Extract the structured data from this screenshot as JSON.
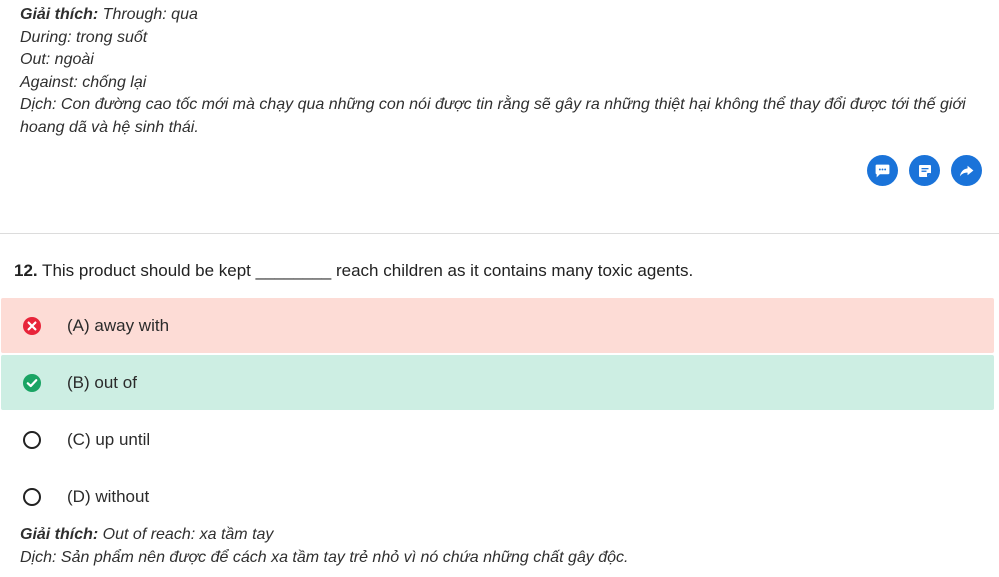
{
  "prev_explanation": {
    "label": "Giải thích:",
    "first": " Through: qua",
    "lines": [
      "During: trong suốt",
      "Out: ngoài",
      "Against: chống lại"
    ],
    "translation": "Dịch: Con đường cao tốc mới mà chạy qua những con nói được tin rằng sẽ gây ra những thiệt hại không thể thay đổi được tới thế giới hoang dã và hệ sinh thái."
  },
  "actions": [
    {
      "icon": "comment-icon"
    },
    {
      "icon": "note-icon"
    },
    {
      "icon": "share-icon"
    }
  ],
  "question": {
    "number": "12.",
    "text": " This product should be kept ________ reach children as it contains many toxic agents."
  },
  "options": [
    {
      "label": "(A) away with",
      "status": "wrong"
    },
    {
      "label": "(B) out of",
      "status": "correct"
    },
    {
      "label": "(C) up until",
      "status": "none"
    },
    {
      "label": "(D) without",
      "status": "none"
    }
  ],
  "explanation": {
    "label": "Giải thích:",
    "first": " Out of reach: xa tầm tay",
    "translation": "Dịch: Sản phẩm nên được để cách xa tầm tay trẻ nhỏ vì nó chứa những chất gây độc."
  },
  "colors": {
    "accent": "#1a73d9",
    "wrong_bg": "#fddcd6",
    "wrong_icon": "#e8243a",
    "correct_bg": "#cdeee3",
    "correct_icon": "#1aa464"
  }
}
